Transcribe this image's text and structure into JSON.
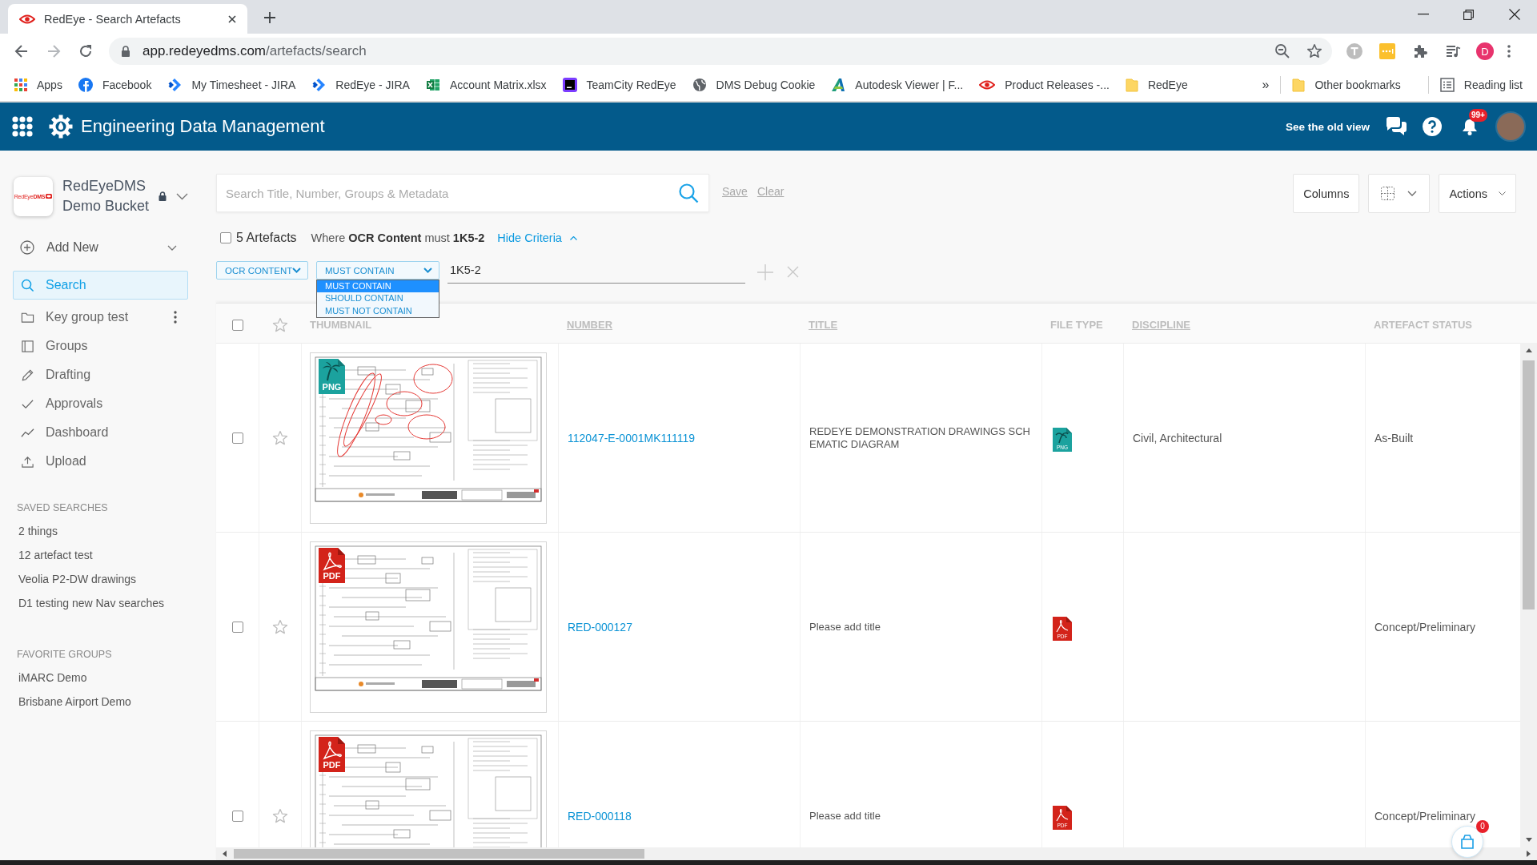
{
  "browser": {
    "tabs": [
      {
        "title": "RedEye - Search Artefacts",
        "selected": true
      }
    ],
    "address": {
      "host": "app.redeyedms.com",
      "path": "/artefacts/search"
    },
    "profile_initial": "D",
    "bookmarks": [
      {
        "label": "Apps",
        "kind": "apps"
      },
      {
        "label": "Facebook",
        "kind": "facebook"
      },
      {
        "label": "My Timesheet - JIRA",
        "kind": "jira"
      },
      {
        "label": "RedEye - JIRA",
        "kind": "jira"
      },
      {
        "label": "Account Matrix.xlsx",
        "kind": "excel"
      },
      {
        "label": "TeamCity RedEye",
        "kind": "teamcity"
      },
      {
        "label": "DMS Debug Cookie",
        "kind": "globe"
      },
      {
        "label": "Autodesk Viewer | F...",
        "kind": "autodesk"
      },
      {
        "label": "Product Releases -...",
        "kind": "redeye"
      },
      {
        "label": "RedEye",
        "kind": "folder"
      }
    ],
    "bookmarks_overflow": "»",
    "other_bookmarks": "Other bookmarks",
    "reading_list": "Reading list"
  },
  "app_header": {
    "title": "Engineering Data Management",
    "old_view_link": "See the old view",
    "notification_badge": "99+"
  },
  "sidebar": {
    "bucket": {
      "logo_text": "RedEye**DMS**",
      "name": "RedEyeDMS Demo Bucket",
      "locked": true
    },
    "add_new": "Add New",
    "nav": [
      {
        "label": "Search",
        "kind": "search",
        "selected": true,
        "menu": false
      },
      {
        "label": "Key group test",
        "kind": "folder",
        "selected": false,
        "menu": true
      },
      {
        "label": "Groups",
        "kind": "book",
        "selected": false,
        "menu": false
      },
      {
        "label": "Drafting",
        "kind": "pencil",
        "selected": false,
        "menu": false
      },
      {
        "label": "Approvals",
        "kind": "check",
        "selected": false,
        "menu": false
      },
      {
        "label": "Dashboard",
        "kind": "trend",
        "selected": false,
        "menu": false
      },
      {
        "label": "Upload",
        "kind": "upload",
        "selected": false,
        "menu": false
      }
    ],
    "saved_searches": {
      "heading": "SAVED SEARCHES",
      "items": [
        "2 things",
        "12 artefact test",
        "Veolia P2-DW drawings",
        "D1 testing new Nav searches"
      ]
    },
    "favorite_groups": {
      "heading": "FAVORITE GROUPS",
      "items": [
        "iMARC Demo",
        "Brisbane Airport Demo"
      ]
    }
  },
  "search": {
    "placeholder": "Search Title, Number, Groups & Metadata",
    "save": "Save",
    "clear": "Clear"
  },
  "toolbar": {
    "columns": "Columns",
    "actions": "Actions"
  },
  "results": {
    "select_all_checked": false,
    "count": "5 Artefacts",
    "criteria": "Where **OCR Content** must **1K5-2**",
    "hide_criteria": "Hide Criteria",
    "criteria_expanded": true
  },
  "filter": {
    "field": "OCR CONTENT",
    "operator": "MUST CONTAIN",
    "value": "1K5-2",
    "operator_menu_open": true,
    "operator_options": [
      {
        "label": "MUST CONTAIN",
        "selected": true
      },
      {
        "label": "SHOULD CONTAIN",
        "selected": false
      },
      {
        "label": "MUST NOT CONTAIN",
        "selected": false
      }
    ]
  },
  "table": {
    "header_checked": false,
    "header_starred": false,
    "columns": [
      {
        "label": "THUMBNAIL",
        "sortable": false
      },
      {
        "label": "NUMBER",
        "sortable": true
      },
      {
        "label": "TITLE",
        "sortable": true
      },
      {
        "label": "FILE TYPE",
        "sortable": false
      },
      {
        "label": "DISCIPLINE",
        "sortable": true
      },
      {
        "label": "ARTEFACT STATUS",
        "sortable": false
      }
    ],
    "rows": [
      {
        "kind": "png",
        "checked": false,
        "starred": false,
        "thumbnail": {
          "annotated": true,
          "badge": "PNG"
        },
        "number": "112047-E-0001MK111119",
        "title": "REDEYE DEMONSTRATION DRAWINGS SCHEMATIC DIAGRAM",
        "file_type": "PNG",
        "discipline": "Civil, Architectural",
        "status": "As-Built"
      },
      {
        "kind": "pdf",
        "checked": false,
        "starred": false,
        "thumbnail": {
          "annotated": false,
          "badge": "PDF"
        },
        "number": "RED-000127",
        "title": "Please add title",
        "file_type": "PDF",
        "status": "Concept/Preliminary"
      },
      {
        "kind": "pdf",
        "checked": false,
        "starred": false,
        "thumbnail": {
          "annotated": false,
          "badge": "PDF"
        },
        "number": "RED-000118",
        "title": "Please add title",
        "file_type": "PDF",
        "status": "Concept/Preliminary"
      }
    ]
  },
  "basket": {
    "count": "0"
  }
}
